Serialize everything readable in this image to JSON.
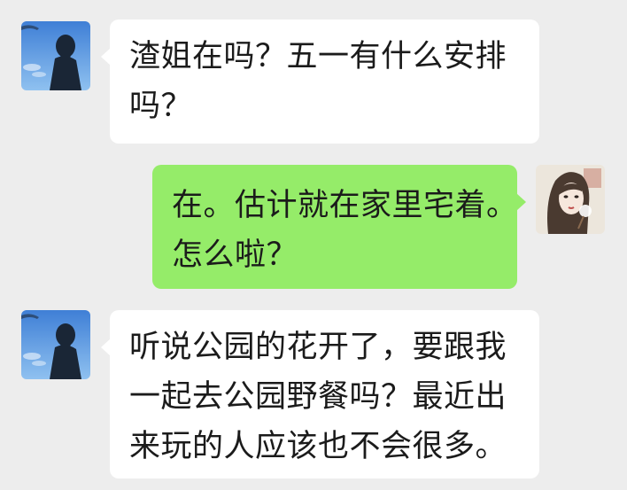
{
  "chat": {
    "messages": [
      {
        "sender": "contact",
        "avatar": "contact-silhouette-avatar",
        "lines": [
          "渣姐在吗？五一有什么安排",
          "吗？"
        ]
      },
      {
        "sender": "me",
        "avatar": "woman-illustration-avatar",
        "lines": [
          "在。估计就在家里宅着。",
          "怎么啦？"
        ]
      },
      {
        "sender": "contact",
        "avatar": "contact-silhouette-avatar",
        "lines": [
          "听说公园的花开了，要跟我",
          "一起去公园野餐吗？最近出",
          "来玩的人应该也不会很多。"
        ]
      }
    ]
  },
  "colors": {
    "background": "#ededed",
    "incoming_bubble": "#ffffff",
    "outgoing_bubble": "#95ec69",
    "text": "#1b1b1b"
  }
}
